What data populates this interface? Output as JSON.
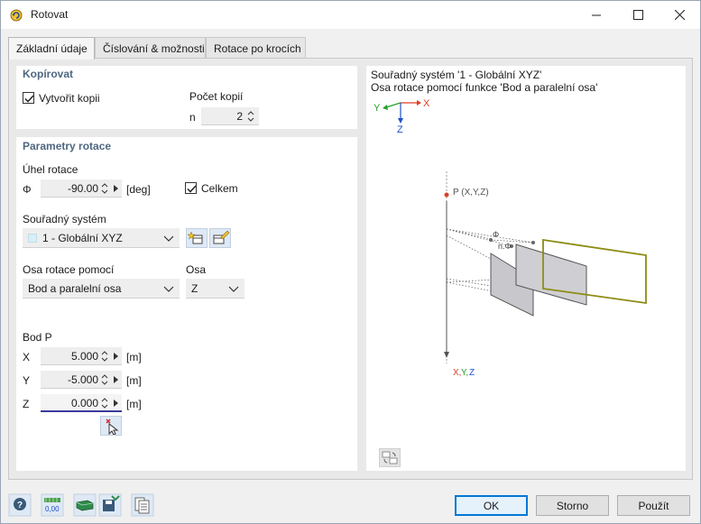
{
  "window": {
    "title": "Rotovat"
  },
  "tabs": [
    {
      "label": "Základní údaje",
      "active": true
    },
    {
      "label": "Číslování & možnosti",
      "active": false
    },
    {
      "label": "Rotace po krocích",
      "active": false
    }
  ],
  "copy": {
    "section_title": "Kopírovat",
    "create_copy_label": "Vytvořit kopii",
    "create_copy_checked": true,
    "count_label": "Počet kopií",
    "n_label": "n",
    "n_value": "2"
  },
  "rotation": {
    "section_title": "Parametry rotace",
    "angle_label": "Úhel rotace",
    "phi_label": "Φ",
    "phi_value": "-90.00",
    "phi_unit": "[deg]",
    "total_label": "Celkem",
    "total_checked": true,
    "cs_label": "Souřadný systém",
    "cs_value": "1 - Globální XYZ",
    "axis_by_label": "Osa rotace pomocí",
    "axis_by_value": "Bod a paralelní osa",
    "axis_label": "Osa",
    "axis_value": "Z",
    "point_label": "Bod P",
    "x_label": "X",
    "x_value": "5.000",
    "x_unit": "[m]",
    "y_label": "Y",
    "y_value": "-5.000",
    "y_unit": "[m]",
    "z_label": "Z",
    "z_value": "0.000",
    "z_unit": "[m]"
  },
  "preview": {
    "line1": "Souřadný systém '1 - Globální XYZ'",
    "line2": "Osa rotace pomocí funkce 'Bod a paralelní osa'",
    "axis_y": "Y",
    "axis_x": "X",
    "axis_z": "Z",
    "point_label": "P (X,Y,Z)",
    "phi_label": "Φ",
    "nphi_label": "n.Φ",
    "axis_caption_x": "X,",
    "axis_caption_y": "Y,",
    "axis_caption_z": "Z"
  },
  "buttons": {
    "ok": "OK",
    "cancel": "Storno",
    "apply": "Použít"
  },
  "footer_value": "0,00",
  "colors": {
    "accent": "#4e6680",
    "plane": "#8c8c14",
    "red": "#e03c28",
    "blue": "#1e50c8",
    "green": "#28a028"
  },
  "icons": [
    "help-icon",
    "units-icon",
    "drive-icon",
    "save-settings-icon",
    "table-icon",
    "select-point-icon",
    "coordinate-system-icon",
    "edit-coordinate-system-icon",
    "preview-refresh-icon"
  ]
}
